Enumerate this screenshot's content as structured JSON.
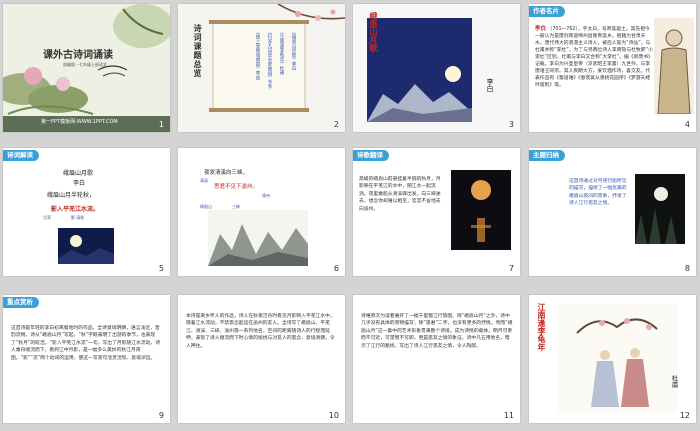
{
  "slides": [
    {
      "num": "1",
      "title": "课外古诗词诵读",
      "subtitle": "部编版・七年级上册语文",
      "footer": "第一PPT模板网-WWW.1PPT.COM"
    },
    {
      "num": "2",
      "heading": "诗词课题总览",
      "items": [
        "《峨眉山月歌》李白",
        "《江南逢李龟年》杜甫",
        "《行军九日思长安故园》岑参",
        "《夜上受降城闻笛》李益"
      ]
    },
    {
      "num": "3",
      "title": "峨眉山月歌",
      "author": "李白"
    },
    {
      "num": "4",
      "tag": "作者名片",
      "lead": "李白",
      "body": "（701—762），字太白，号青莲居士。其先祖今一般认为是唐剑南道绵州昌隆青莲乡。祖籍为甘肃天水，唐代伟大的浪漫主义诗人，被后人誉为“诗仙”，与杜甫并称“李杜”，为了与另两位诗人李商隐与杜牧即“小李杜”区别，杜甫与李白又合称“大李杜”。据《新唐书》记载，李白为兴圣皇帝（凉武昭王李暠）九世孙，与李唐诸王同宗。其人爽朗大方，爱饮酒作诗，喜交友。代表作品有《蜀道难》《春夜宴从弟桃花园序》《梦游天姥吟留别》等。"
    },
    {
      "num": "5",
      "tag": "诗词解读",
      "poem": [
        "峨眉山月歌",
        "李白",
        "峨眉山月半轮秋，",
        "影入平羌江水流。"
      ],
      "labels": [
        "月亮",
        "影·清秋"
      ]
    },
    {
      "num": "6",
      "lines": [
        "夜发清溪向三峡，",
        "思君不见下渝州。"
      ],
      "labels": [
        "清溪",
        "渝州",
        "峨眉山",
        "三峡"
      ]
    },
    {
      "num": "7",
      "tag": "诗歌翻译",
      "body": "高峻的峨眉山前悬挂着半圆的秋月，月影映在平羌江的水中，随江水一起流淌。夜里乘船从清溪驿出发，向三峡驶去，想念你却难以相见，恋恋不舍地去向渝州。"
    },
    {
      "num": "8",
      "tag": "主题归纳",
      "body": "这首诗通过对月夜行船所见的描写，描绘了一幅优美的峨眉山夜间的景象，抒发了诗人江行思友之情。"
    },
    {
      "num": "9",
      "tag": "重点赏析",
      "body": "这首诗是年轻的李白初离蜀地时的作品，全诗意境明朗，语言浅近，音韵流畅。诗从“峨眉山月”写起，“秋”字既表明了出游的季节，也表现了“秋月”的皎洁。“影入平羌江水流”一句，写出了月影随江水流动，诗人乘舟顺流而下，看到江中月影，是一幅多么美妙的秋江月夜图。“影”“流”两个动词的运用，使这一写景句活灵活现、意境深远。"
    },
    {
      "num": "10",
      "body": "本诗是离乡怀人的作品，诗人在秋夜泛舟时看见月影映入平羌江水中，随着江水流动，不禁思念起远在渝州的友人。全诗写了峨眉山、平羌江、清溪、三峡、渝州等一系列地名，空间的距离随诗人的行程而延伸，表现了诗人顺流而下时心情的愉悦与对友人的思念，意境清朗，令人神往。"
    },
    {
      "num": "11",
      "body": "诗唯原次为读者展开了一幅千里蜀江行旅图。除“峨眉山月”之外，诗中几乎没有具体的景物描写；除“思君”二字，也没有更多的抒情。然而“峨眉山月”这一集中的艺术形象贯串整个诗境，成为诗情的载体。明月可亲而不可近，可望而不可即，更是思友之情的象征。诗中凡五用地名，暗示了江行的路线，写出了诗人江行思友之情，令人陶醉。"
    },
    {
      "num": "12",
      "title": "江南逢李龟年",
      "author": "杜甫"
    }
  ]
}
